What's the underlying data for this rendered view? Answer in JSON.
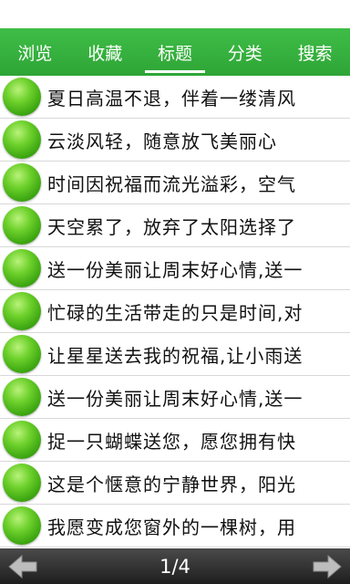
{
  "tabs": [
    {
      "label": "浏览"
    },
    {
      "label": "收藏"
    },
    {
      "label": "标题"
    },
    {
      "label": "分类"
    },
    {
      "label": "搜索"
    }
  ],
  "active_tab": "标题",
  "items": [
    {
      "title": "夏日高温不退，伴着一缕清风"
    },
    {
      "title": "云淡风轻，随意放飞美丽心"
    },
    {
      "title": "时间因祝福而流光溢彩，空气"
    },
    {
      "title": "天空累了，放弃了太阳选择了"
    },
    {
      "title": "送一份美丽让周末好心情,送一"
    },
    {
      "title": "忙碌的生活带走的只是时间,对"
    },
    {
      "title": "让星星送去我的祝福,让小雨送"
    },
    {
      "title": "送一份美丽让周末好心情,送一"
    },
    {
      "title": "捉一只蝴蝶送您，愿您拥有快"
    },
    {
      "title": "这是个惬意的宁静世界，阳光"
    },
    {
      "title": "我愿变成您窗外的一棵树，用"
    }
  ],
  "pagination": {
    "label": "1/4"
  },
  "icons": {
    "prev": "left-arrow-icon",
    "next": "right-arrow-icon",
    "item": "green-orb-icon"
  },
  "colors": {
    "tab_bar": "#34ad3c",
    "footer": "#2a2a2a"
  }
}
